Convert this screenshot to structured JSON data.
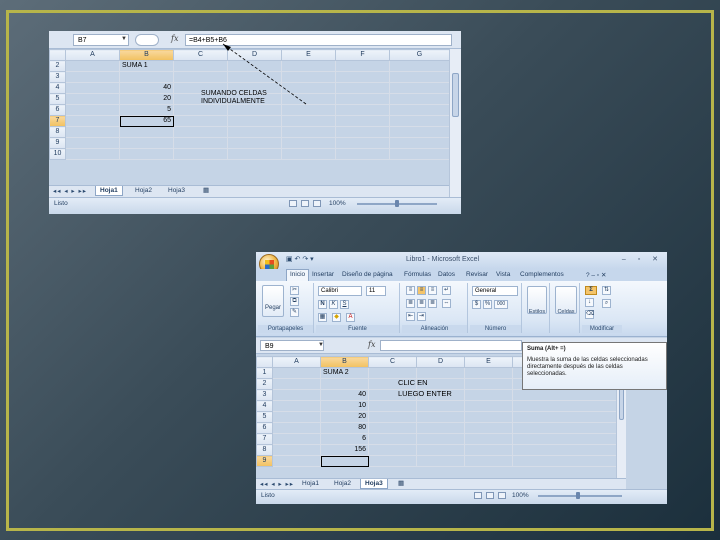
{
  "shot1": {
    "name_box": "B7",
    "fx_symbol": "fx",
    "formula": "=B4+B5+B6",
    "columns": [
      "A",
      "B",
      "C",
      "D",
      "E",
      "F",
      "G"
    ],
    "rows": [
      {
        "n": "2",
        "b": "SUMA 1"
      },
      {
        "n": "3",
        "b": ""
      },
      {
        "n": "4",
        "b": "40"
      },
      {
        "n": "5",
        "b": "20"
      },
      {
        "n": "6",
        "b": "5"
      },
      {
        "n": "7",
        "b": "65"
      },
      {
        "n": "8",
        "b": ""
      },
      {
        "n": "9",
        "b": ""
      },
      {
        "n": "10",
        "b": ""
      }
    ],
    "annotation_line1": "SUMANDO CELDAS",
    "annotation_line2": "INDIVIDUALMENTE",
    "sheet_nav": "◂◂ ◂ ▸ ▸▸",
    "tabs": [
      "Hoja1",
      "Hoja2",
      "Hoja3"
    ],
    "status_ready": "Listo",
    "zoom": "100%"
  },
  "shot2": {
    "window_title": "Libro1 - Microsoft Excel",
    "window_controls": "– ▫ ✕",
    "ribbon_tabs": [
      "Inicio",
      "Insertar",
      "Diseño de página",
      "Fórmulas",
      "Datos",
      "Revisar",
      "Vista",
      "Complementos"
    ],
    "groups": {
      "clipboard": "Portapapeles",
      "paste": "Pegar",
      "font": "Fuente",
      "font_name": "Calibri",
      "font_size": "11",
      "bold": "N",
      "italic": "K",
      "underline": "S",
      "alignment": "Alineación",
      "number": "Número",
      "number_format": "General",
      "currency": "$",
      "percent": "%",
      "thousands": "000",
      "styles": "Estilos",
      "cells": "Celdas",
      "modify": "Modificar",
      "sigma": "Σ"
    },
    "name_box": "B9",
    "fx_symbol": "fx",
    "formula": "",
    "columns": [
      "A",
      "B",
      "C",
      "D",
      "E"
    ],
    "rows": [
      {
        "n": "1",
        "b": "SUMA 2"
      },
      {
        "n": "2",
        "b": ""
      },
      {
        "n": "3",
        "b": "40"
      },
      {
        "n": "4",
        "b": "10"
      },
      {
        "n": "5",
        "b": "20"
      },
      {
        "n": "6",
        "b": "80"
      },
      {
        "n": "7",
        "b": "6"
      },
      {
        "n": "8",
        "b": "156"
      },
      {
        "n": "9",
        "b": ""
      }
    ],
    "annotation_line1": "CLIC EN",
    "annotation_line2": "LUEGO ENTER",
    "tooltip_title": "Suma (Alt+ =)",
    "tooltip_body": "Muestra la suma de las celdas seleccionadas directamente después de las celdas seleccionadas.",
    "sheet_nav": "◂◂ ◂ ▸ ▸▸",
    "tabs": [
      "Hoja1",
      "Hoja2",
      "Hoja3"
    ],
    "status_ready": "Listo",
    "zoom": "100%"
  }
}
